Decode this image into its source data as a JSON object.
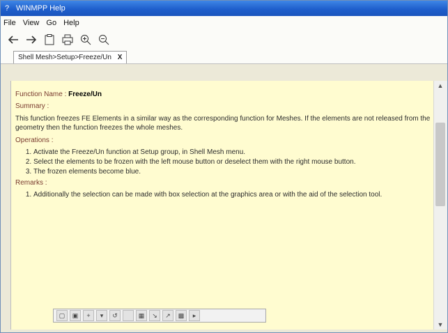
{
  "window": {
    "title": "WINMPP Help"
  },
  "menu": [
    {
      "label": "File"
    },
    {
      "label": "View"
    },
    {
      "label": "Go"
    },
    {
      "label": "Help"
    }
  ],
  "toolbar": [
    "back-icon",
    "forward-icon",
    "clipboard-icon",
    "print-icon",
    "zoom-in-icon",
    "zoom-out-icon"
  ],
  "tab": {
    "label": "Shell Mesh>Setup>Freeze/Un",
    "close": "X"
  },
  "doc": {
    "function_label": "Function Name :",
    "function_name": "Freeze/Un",
    "summary_label": "Summary :",
    "summary_text": "This function freezes FE Elements in a similar way as the corresponding function for Meshes. If the elements are not released from the geometry then the function freezes the whole meshes.",
    "operations_label": "Operations :",
    "operations": [
      "Activate the Freeze/Un function at Setup group, in Shell Mesh menu.",
      "Select the elements to be frozen with the left mouse button or deselect them with the right mouse button.",
      "The frozen elements become blue."
    ],
    "remarks_label": "Remarks :",
    "remarks": [
      "Additionally the selection can be made with box selection at the graphics area or with the aid of the selection tool."
    ]
  }
}
